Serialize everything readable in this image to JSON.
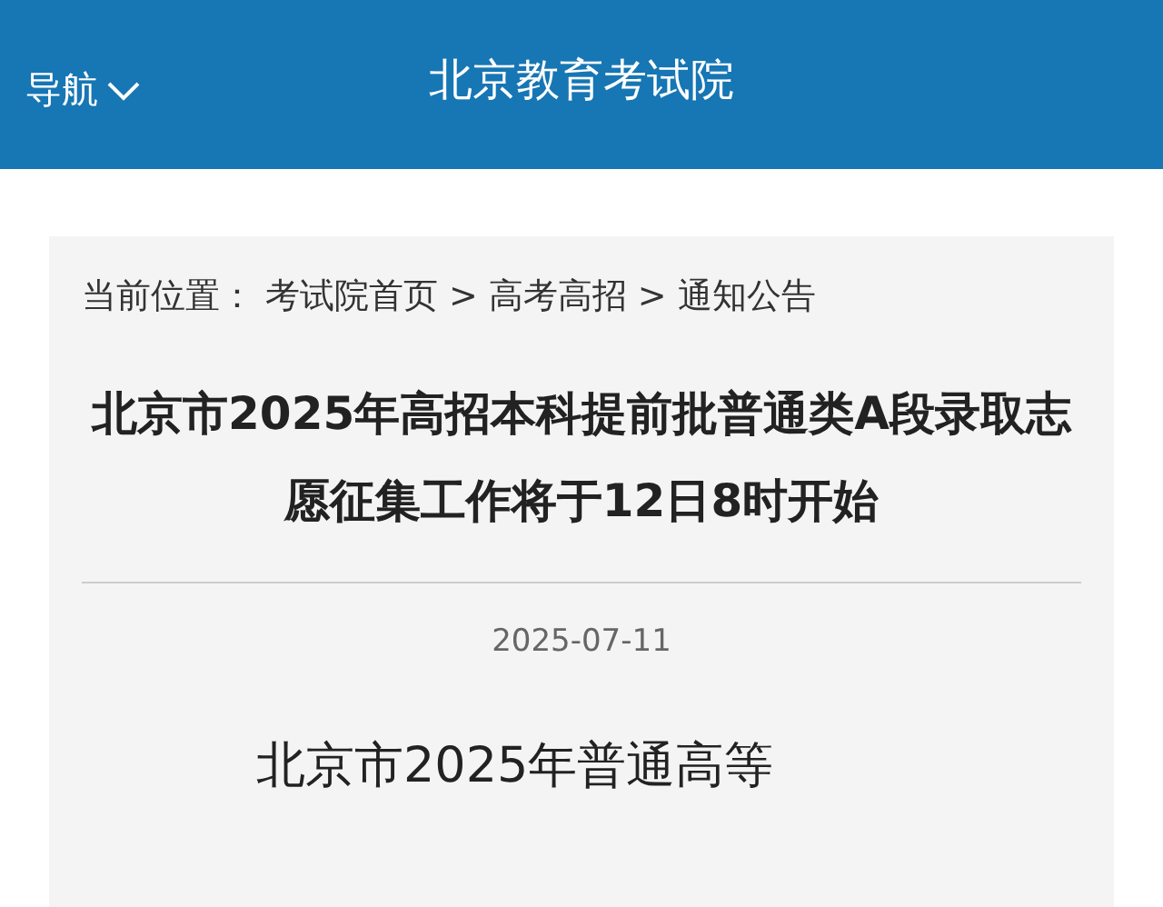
{
  "header": {
    "nav_label": "导航",
    "site_title": "北京教育考试院"
  },
  "breadcrumb": {
    "prefix": "当前位置：",
    "items": [
      "考试院首页",
      "高考高招",
      "通知公告"
    ],
    "separator": ">"
  },
  "article": {
    "title": "北京市2025年高招本科提前批普通类A段录取志愿征集工作将于12日8时开始",
    "date": "2025-07-11",
    "body": "北京市2025年普通高等"
  }
}
